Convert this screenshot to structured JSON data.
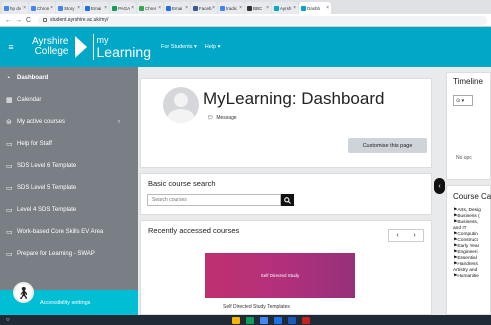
{
  "browser": {
    "tabs": [
      {
        "label": "hp dv",
        "color": "#4285f4"
      },
      {
        "label": "Chron",
        "color": "#4285f4"
      },
      {
        "label": "Story",
        "color": "#4285f4"
      },
      {
        "label": "Emai",
        "color": "#1a73e8"
      },
      {
        "label": "PAGA",
        "color": "#0f9d58"
      },
      {
        "label": "Chrer",
        "color": "#34a853"
      },
      {
        "label": "Emai",
        "color": "#1a73e8"
      },
      {
        "label": "Faceb",
        "color": "#3b5998"
      },
      {
        "label": "tradic",
        "color": "#4285f4"
      },
      {
        "label": "BBC",
        "color": "#333333"
      },
      {
        "label": "Ayrsh",
        "color": "#00a7c7"
      },
      {
        "label": "Dashb",
        "color": "#00a7c7"
      }
    ],
    "url": "student.ayrshire.ac.uk/my/"
  },
  "header": {
    "logo_line1": "Ayrshire",
    "logo_line2": "College",
    "logo_my": "my",
    "logo_learning": "Learning",
    "nav_students": "For Students ▾",
    "nav_help": "Help ▾",
    "brand_color": "#00a7c7"
  },
  "sidebar": {
    "items": [
      {
        "icon": "◔",
        "label": "Dashboard"
      },
      {
        "icon": "▦",
        "label": "Calendar"
      },
      {
        "icon": "⊜",
        "label": "My active courses",
        "chevron": "‹"
      },
      {
        "icon": "▭",
        "label": "Help for Staff"
      },
      {
        "icon": "▭",
        "label": "SDS Level 6 Template"
      },
      {
        "icon": "▭",
        "label": "SDS Level 5 Template"
      },
      {
        "icon": "▭",
        "label": "Level 4 SDS Template"
      },
      {
        "icon": "▭",
        "label": "Work-based Core Skills EV Area"
      },
      {
        "icon": "▭",
        "label": "Prepare for Learning - SWAP"
      }
    ],
    "accessibility": "Accessibility settings"
  },
  "dashboard": {
    "title": "MyLearning: Dashboard",
    "message": "Message",
    "customise": "Customise this page"
  },
  "search": {
    "heading": "Basic course search",
    "placeholder": "Search courses"
  },
  "recent": {
    "heading": "Recently accessed courses",
    "prev": "‹",
    "next": "›",
    "course_image_text": "Self Directed Study",
    "course_name": "Self Directed Study Templates"
  },
  "timeline": {
    "heading": "Timeline",
    "select": "⊙ ▾",
    "empty": "No upc"
  },
  "course_categories": {
    "heading": "Course Ca",
    "items": [
      "Arts, Desig",
      "Business (",
      "Business,",
      "and IT",
      "Computin",
      "Construct",
      "Early Year",
      "Engineeri",
      "Essential",
      "Hairdress",
      "Artistry and",
      "Humanitie"
    ]
  }
}
